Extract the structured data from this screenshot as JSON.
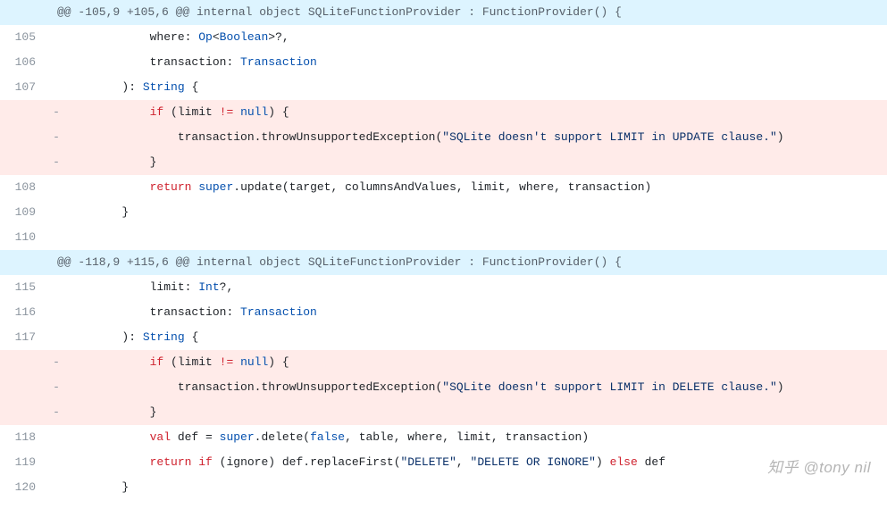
{
  "hunks": [
    {
      "header": "@@ -105,9 +105,6 @@ internal object SQLiteFunctionProvider : FunctionProvider() {",
      "lines": [
        {
          "num": "105",
          "type": "ctx",
          "tokens": [
            {
              "t": "default",
              "v": "            where"
            },
            {
              "t": "punct",
              "v": ": "
            },
            {
              "t": "type",
              "v": "Op"
            },
            {
              "t": "punct",
              "v": "<"
            },
            {
              "t": "type",
              "v": "Boolean"
            },
            {
              "t": "punct",
              "v": ">?,"
            }
          ]
        },
        {
          "num": "106",
          "type": "ctx",
          "tokens": [
            {
              "t": "default",
              "v": "            transaction"
            },
            {
              "t": "punct",
              "v": ": "
            },
            {
              "t": "type",
              "v": "Transaction"
            }
          ]
        },
        {
          "num": "107",
          "type": "ctx",
          "tokens": [
            {
              "t": "default",
              "v": "        )"
            },
            {
              "t": "punct",
              "v": ": "
            },
            {
              "t": "type",
              "v": "String"
            },
            {
              "t": "default",
              "v": " {"
            }
          ]
        },
        {
          "num": "",
          "type": "del",
          "tokens": [
            {
              "t": "default",
              "v": "            "
            },
            {
              "t": "keyword",
              "v": "if"
            },
            {
              "t": "default",
              "v": " (limit "
            },
            {
              "t": "keyword",
              "v": "!="
            },
            {
              "t": "default",
              "v": " "
            },
            {
              "t": "literal",
              "v": "null"
            },
            {
              "t": "default",
              "v": ") {"
            }
          ]
        },
        {
          "num": "",
          "type": "del",
          "tokens": [
            {
              "t": "default",
              "v": "                transaction.throwUnsupportedException("
            },
            {
              "t": "string",
              "v": "\"SQLite doesn't support LIMIT in UPDATE clause.\""
            },
            {
              "t": "default",
              "v": ")"
            }
          ]
        },
        {
          "num": "",
          "type": "del",
          "tokens": [
            {
              "t": "default",
              "v": "            }"
            }
          ]
        },
        {
          "num": "108",
          "type": "ctx",
          "tokens": [
            {
              "t": "default",
              "v": "            "
            },
            {
              "t": "keyword",
              "v": "return"
            },
            {
              "t": "default",
              "v": " "
            },
            {
              "t": "literal",
              "v": "super"
            },
            {
              "t": "default",
              "v": ".update(target, columnsAndValues, limit, where, transaction)"
            }
          ]
        },
        {
          "num": "109",
          "type": "ctx",
          "tokens": [
            {
              "t": "default",
              "v": "        }"
            }
          ]
        },
        {
          "num": "110",
          "type": "ctx",
          "tokens": [
            {
              "t": "default",
              "v": ""
            }
          ]
        }
      ]
    },
    {
      "header": "@@ -118,9 +115,6 @@ internal object SQLiteFunctionProvider : FunctionProvider() {",
      "lines": [
        {
          "num": "115",
          "type": "ctx",
          "tokens": [
            {
              "t": "default",
              "v": "            limit"
            },
            {
              "t": "punct",
              "v": ": "
            },
            {
              "t": "type",
              "v": "Int"
            },
            {
              "t": "punct",
              "v": "?,"
            }
          ]
        },
        {
          "num": "116",
          "type": "ctx",
          "tokens": [
            {
              "t": "default",
              "v": "            transaction"
            },
            {
              "t": "punct",
              "v": ": "
            },
            {
              "t": "type",
              "v": "Transaction"
            }
          ]
        },
        {
          "num": "117",
          "type": "ctx",
          "tokens": [
            {
              "t": "default",
              "v": "        )"
            },
            {
              "t": "punct",
              "v": ": "
            },
            {
              "t": "type",
              "v": "String"
            },
            {
              "t": "default",
              "v": " {"
            }
          ]
        },
        {
          "num": "",
          "type": "del",
          "tokens": [
            {
              "t": "default",
              "v": "            "
            },
            {
              "t": "keyword",
              "v": "if"
            },
            {
              "t": "default",
              "v": " (limit "
            },
            {
              "t": "keyword",
              "v": "!="
            },
            {
              "t": "default",
              "v": " "
            },
            {
              "t": "literal",
              "v": "null"
            },
            {
              "t": "default",
              "v": ") {"
            }
          ]
        },
        {
          "num": "",
          "type": "del",
          "tokens": [
            {
              "t": "default",
              "v": "                transaction.throwUnsupportedException("
            },
            {
              "t": "string",
              "v": "\"SQLite doesn't support LIMIT in DELETE clause.\""
            },
            {
              "t": "default",
              "v": ")"
            }
          ]
        },
        {
          "num": "",
          "type": "del",
          "tokens": [
            {
              "t": "default",
              "v": "            }"
            }
          ]
        },
        {
          "num": "118",
          "type": "ctx",
          "tokens": [
            {
              "t": "default",
              "v": "            "
            },
            {
              "t": "keyword",
              "v": "val"
            },
            {
              "t": "default",
              "v": " def = "
            },
            {
              "t": "literal",
              "v": "super"
            },
            {
              "t": "default",
              "v": ".delete("
            },
            {
              "t": "literal",
              "v": "false"
            },
            {
              "t": "default",
              "v": ", table, where, limit, transaction)"
            }
          ]
        },
        {
          "num": "119",
          "type": "ctx",
          "tokens": [
            {
              "t": "default",
              "v": "            "
            },
            {
              "t": "keyword",
              "v": "return"
            },
            {
              "t": "default",
              "v": " "
            },
            {
              "t": "keyword",
              "v": "if"
            },
            {
              "t": "default",
              "v": " (ignore) def.replaceFirst("
            },
            {
              "t": "string",
              "v": "\"DELETE\""
            },
            {
              "t": "default",
              "v": ", "
            },
            {
              "t": "string",
              "v": "\"DELETE OR IGNORE\""
            },
            {
              "t": "default",
              "v": ") "
            },
            {
              "t": "keyword",
              "v": "else"
            },
            {
              "t": "default",
              "v": " def"
            }
          ]
        },
        {
          "num": "120",
          "type": "ctx",
          "tokens": [
            {
              "t": "default",
              "v": "        }"
            }
          ]
        }
      ]
    }
  ],
  "watermark": "知乎 @tony nil"
}
